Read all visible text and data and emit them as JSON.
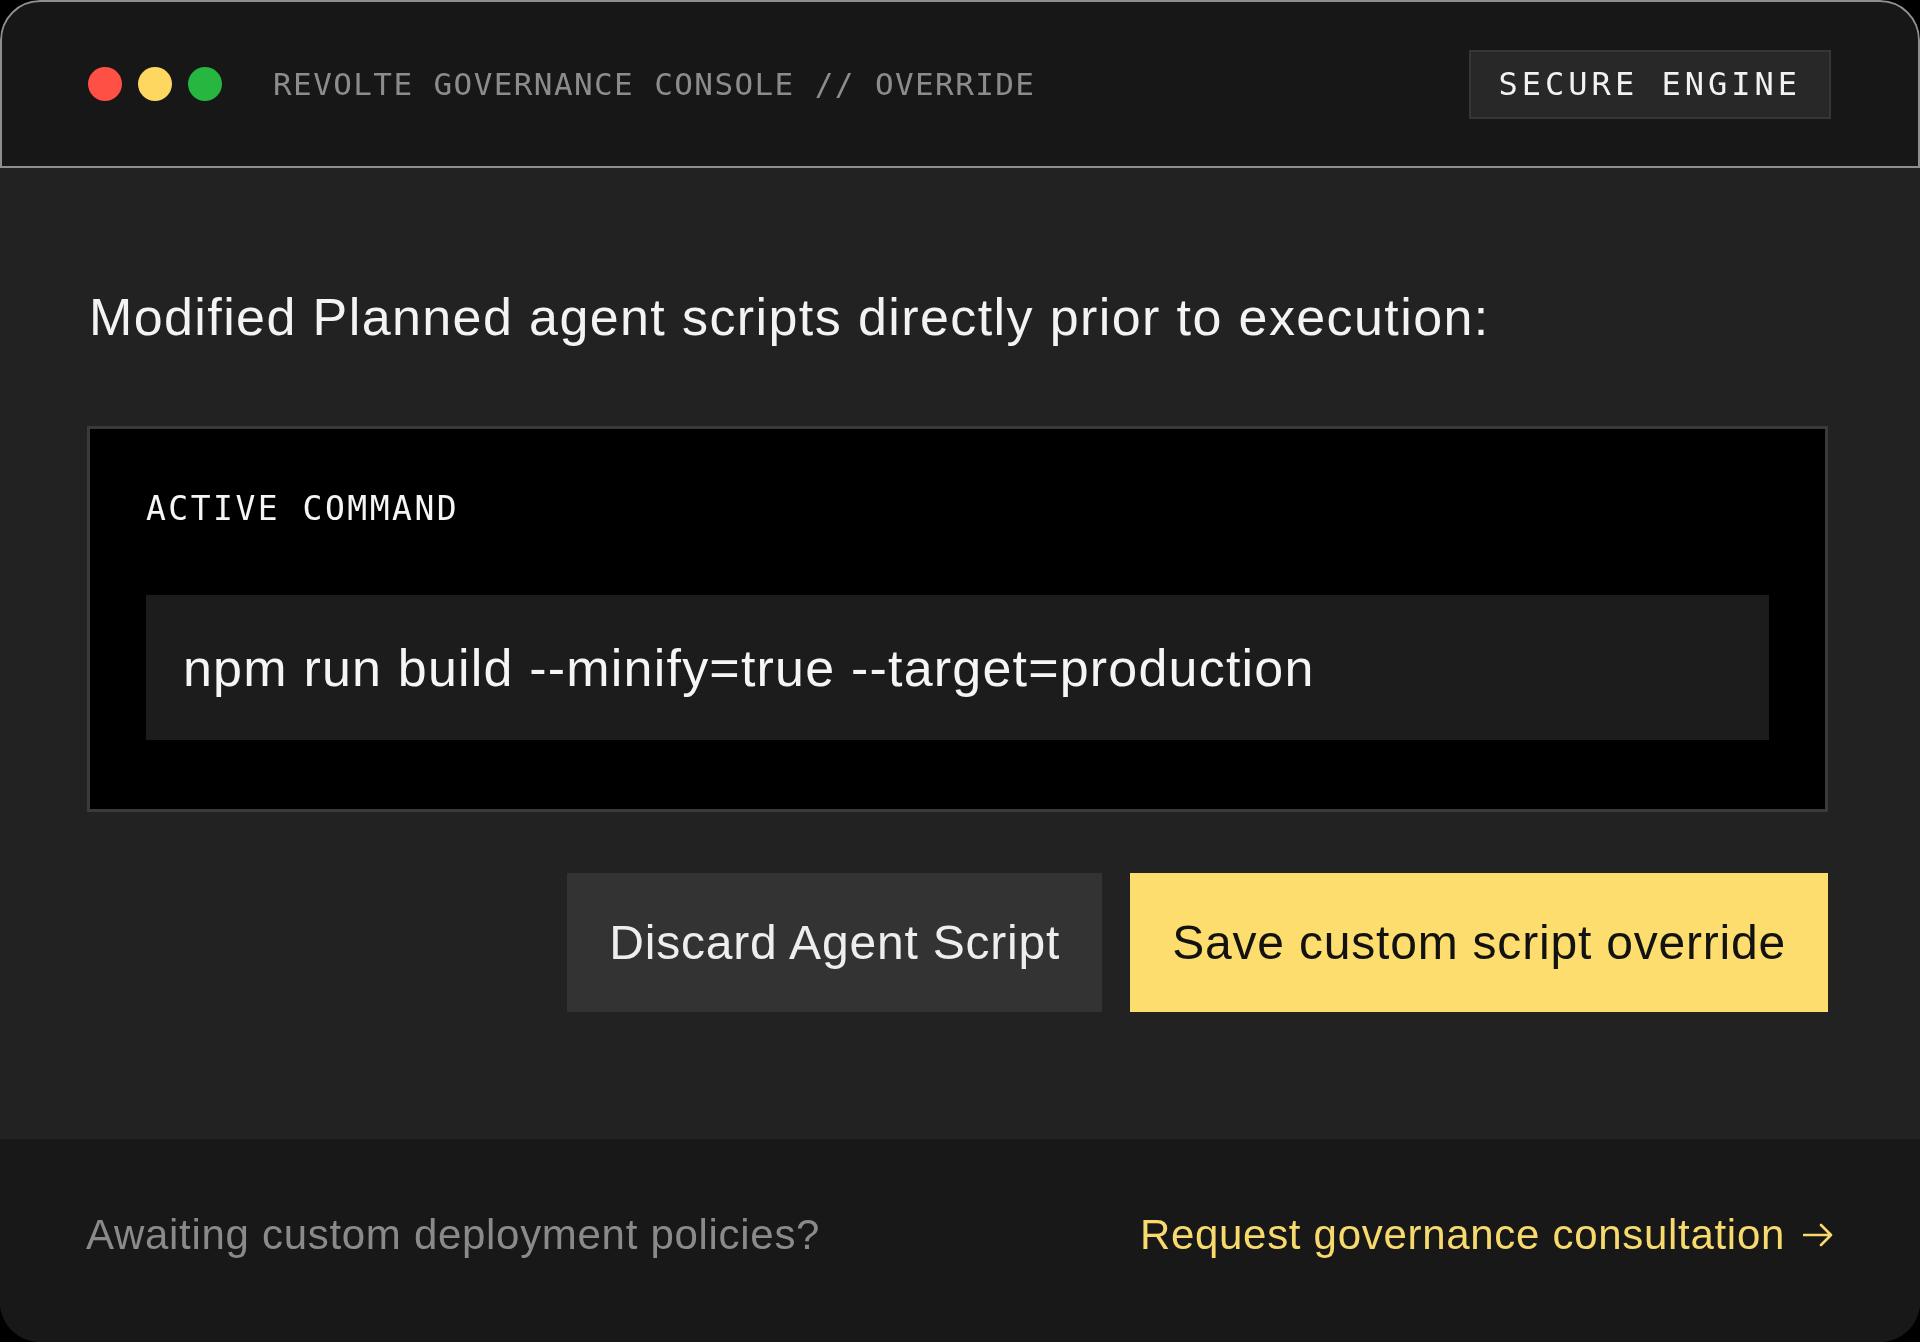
{
  "window": {
    "controls": [
      {
        "color": "#fe5045"
      },
      {
        "color": "#fdd760"
      },
      {
        "color": "#27b640"
      }
    ],
    "title": "REVOLTE GOVERNANCE CONSOLE // OVERRIDE",
    "badge": "SECURE ENGINE"
  },
  "heading": "Modified Planned agent scripts directly prior to execution:",
  "command_panel": {
    "label": "ACTIVE COMMAND",
    "command": "npm run build --minify=true --target=production"
  },
  "buttons": [
    {
      "label": "Discard Agent Script",
      "kind": "secondary"
    },
    {
      "label": "Save custom script override",
      "kind": "primary"
    }
  ],
  "footer": {
    "text": "Awaiting custom deployment policies?",
    "link": "Request governance consultation"
  }
}
